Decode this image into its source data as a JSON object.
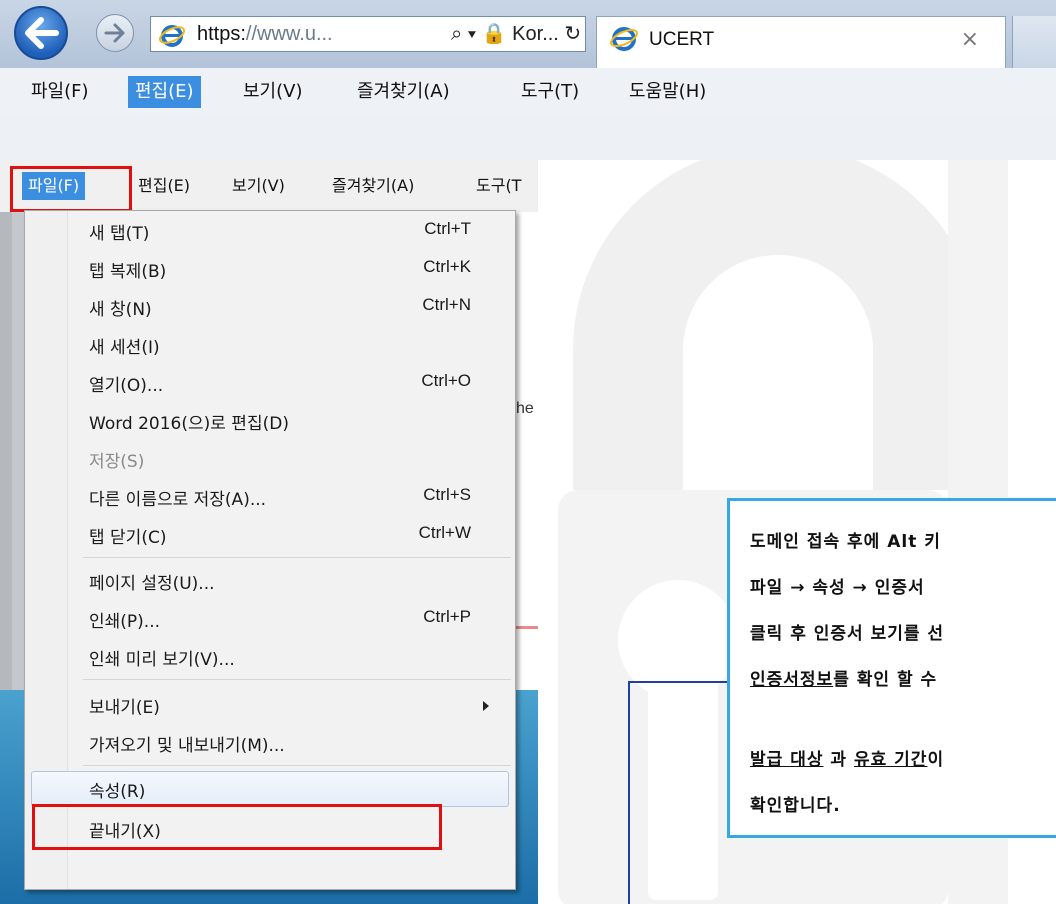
{
  "browser": {
    "url_proto": "https:",
    "url_host": "//www.u...",
    "url_tools": "⌕ ▾  🔒 Kor... ↻",
    "tab_title": "UCERT",
    "tab_close": "×"
  },
  "menubar": [
    "파일(F)",
    "편집(E)",
    "보기(V)",
    "즐겨찾기(A)",
    "도구(T)",
    "도움말(H)"
  ],
  "inset_menubar": [
    "파일(F)",
    "편집(E)",
    "보기(V)",
    "즐겨찾기(A)",
    "도구(T"
  ],
  "inset_fragment": "he",
  "file_menu": {
    "new_tab": {
      "label": "새 탭(T)",
      "shortcut": "Ctrl+T"
    },
    "dup_tab": {
      "label": "탭 복제(B)",
      "shortcut": "Ctrl+K"
    },
    "new_window": {
      "label": "새 창(N)",
      "shortcut": "Ctrl+N"
    },
    "new_session": {
      "label": "새 세션(I)"
    },
    "open": {
      "label": "열기(O)...",
      "shortcut": "Ctrl+O"
    },
    "edit_word": {
      "label": "Word 2016(으)로 편집(D)"
    },
    "save": {
      "label": "저장(S)"
    },
    "save_as": {
      "label": "다른 이름으로 저장(A)...",
      "shortcut": "Ctrl+S"
    },
    "close_tab": {
      "label": "탭 닫기(C)",
      "shortcut": "Ctrl+W"
    },
    "page_setup": {
      "label": "페이지 설정(U)..."
    },
    "print": {
      "label": "인쇄(P)...",
      "shortcut": "Ctrl+P"
    },
    "print_preview": {
      "label": "인쇄 미리 보기(V)..."
    },
    "send": {
      "label": "보내기(E)"
    },
    "import_export": {
      "label": "가져오기 및 내보내기(M)..."
    },
    "properties": {
      "label": "속성(R)"
    },
    "exit": {
      "label": "끝내기(X)"
    }
  },
  "callout": {
    "line1": "도메인 접속 후에 Alt 키",
    "line2": "파일 → 속성 → 인증서",
    "line3": "클릭 후 인증서 보기를 선",
    "line4_u": "인증서정보",
    "line4_rest": "를 확인 할 수",
    "line5_u1": "발급 대상",
    "line5_mid": " 과 ",
    "line5_u2": "유효 기간",
    "line5_rest": "이",
    "line6": "확인합니다."
  },
  "colors": {
    "highlight": "#e01010",
    "callout_border": "#36a9e0",
    "connector": "#1f3fa3",
    "menu_active": "#3c8fe0"
  }
}
